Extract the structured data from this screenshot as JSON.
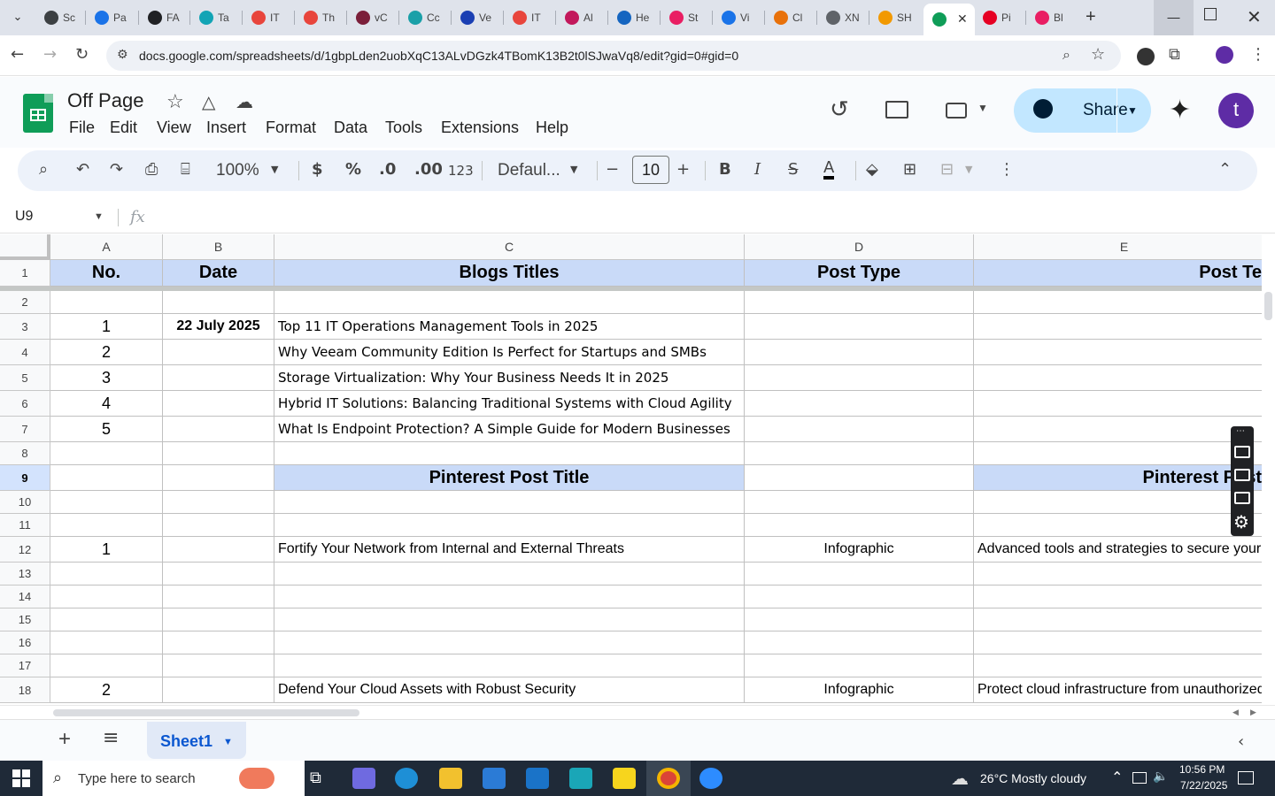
{
  "browser": {
    "tabs": [
      {
        "label": "Sc",
        "color": "#3c4043"
      },
      {
        "label": "Pa",
        "color": "#1a73e8"
      },
      {
        "label": "FA",
        "color": "#202124"
      },
      {
        "label": "Ta",
        "color": "#12a4b5"
      },
      {
        "label": "IT",
        "color": "#e8453c"
      },
      {
        "label": "Th",
        "color": "#e8453c"
      },
      {
        "label": "vC",
        "color": "#7b1f3a"
      },
      {
        "label": "Cc",
        "color": "#1aa0a8"
      },
      {
        "label": "Ve",
        "color": "#1a3fb3"
      },
      {
        "label": "IT",
        "color": "#e8453c"
      },
      {
        "label": "Al",
        "color": "#c2185b"
      },
      {
        "label": "He",
        "color": "#1565c0"
      },
      {
        "label": "St",
        "color": "#e91e63"
      },
      {
        "label": "Vi",
        "color": "#1a73e8"
      },
      {
        "label": "Cl",
        "color": "#e8710a"
      },
      {
        "label": "XN",
        "color": "#5f6368"
      },
      {
        "label": "SH",
        "color": "#f29900"
      },
      {
        "label": "",
        "color": "#0f9d58",
        "active": true
      },
      {
        "label": "Pi",
        "color": "#e60023"
      },
      {
        "label": "Bl",
        "color": "#e91e63"
      }
    ],
    "new_tab": "+",
    "url": "docs.google.com/spreadsheets/d/1gbpLden2uobXqC13ALvDGzk4TBomK13B2t0lSJwaVq8/edit?gid=0#gid=0"
  },
  "doc": {
    "title": "Off Page",
    "menus": [
      "File",
      "Edit",
      "View",
      "Insert",
      "Format",
      "Data",
      "Tools",
      "Extensions",
      "Help"
    ],
    "share": "Share",
    "avatar": "t"
  },
  "toolbar": {
    "zoom": "100%",
    "currency": "$",
    "percent": "%",
    "dec_less": ".0",
    "dec_more": ".00",
    "number_format": "123",
    "font": "Defaul...",
    "font_size": "10",
    "bold": "B",
    "italic": "I",
    "strike": "S",
    "text_color": "A"
  },
  "formula_bar": {
    "name_box": "U9",
    "fx": "fx",
    "content": ""
  },
  "grid": {
    "columns": [
      "A",
      "B",
      "C",
      "D",
      "E"
    ],
    "rows": [
      "1",
      "2",
      "3",
      "4",
      "5",
      "6",
      "7",
      "8",
      "9",
      "10",
      "11",
      "12",
      "13",
      "14",
      "15",
      "16",
      "17",
      "18"
    ],
    "header": {
      "a": "No.",
      "b": "Date",
      "c": "Blogs Titles",
      "d": "Post Type",
      "e": "Post Te"
    },
    "blogs": [
      {
        "no": "1",
        "date": "22 July 2025",
        "title": "Top 11 IT Operations Management Tools in 2025"
      },
      {
        "no": "2",
        "date": "",
        "title": "Why Veeam Community Edition Is Perfect for Startups and SMBs"
      },
      {
        "no": "3",
        "date": "",
        "title": "Storage Virtualization: Why Your Business Needs It in 2025"
      },
      {
        "no": "4",
        "date": "",
        "title": "Hybrid IT Solutions: Balancing Traditional Systems with Cloud Agility"
      },
      {
        "no": "5",
        "date": "",
        "title": "What Is Endpoint Protection? A Simple Guide for Modern Businesses"
      }
    ],
    "pinterest_header": {
      "c": "Pinterest Post Title",
      "e": "Pinterest Post"
    },
    "pins": [
      {
        "no": "1",
        "title": "Fortify Your Network from Internal and External Threats",
        "type": "Infographic",
        "text": "Advanced tools and strategies to secure your"
      },
      {
        "no": "2",
        "title": "Defend Your Cloud Assets with Robust Security",
        "type": "Infographic",
        "text": "Protect cloud infrastructure from unauthorized"
      }
    ]
  },
  "sheets": {
    "add": "+",
    "all": "≡",
    "active": "Sheet1"
  },
  "taskbar": {
    "search_placeholder": "Type here to search",
    "weather": "26°C  Mostly cloudy",
    "time": "10:56 PM",
    "date": "7/22/2025"
  }
}
